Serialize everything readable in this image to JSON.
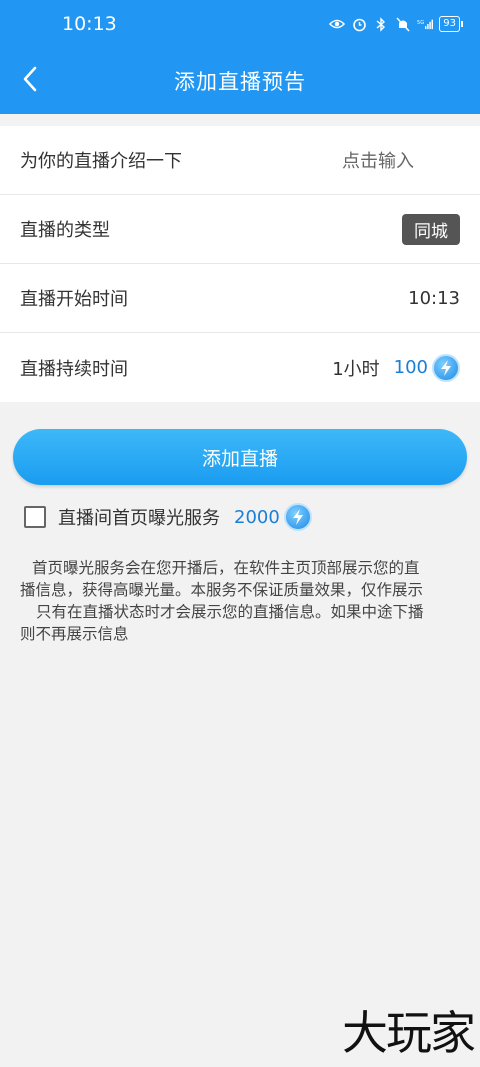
{
  "status_bar": {
    "time": "10:13",
    "battery": "93",
    "icons": [
      "eye-icon",
      "alarm-icon",
      "bluetooth-icon",
      "mute-icon",
      "5g-signal-icon"
    ]
  },
  "nav": {
    "back_icon": "chevron-left-icon",
    "title": "添加直播预告"
  },
  "form": {
    "intro": {
      "label": "为你的直播介绍一下",
      "placeholder": "点击输入"
    },
    "type": {
      "label": "直播的类型",
      "value": "同城"
    },
    "start": {
      "label": "直播开始时间",
      "value": "10:13"
    },
    "duration": {
      "label": "直播持续时间",
      "value": "1小时",
      "coins": "100",
      "coin_icon": "lightning-coin-icon"
    }
  },
  "add_button": {
    "label": "添加直播"
  },
  "service": {
    "label": "直播间首页曝光服务",
    "coins": "2000",
    "checked": false
  },
  "description": {
    "line1": "首页曝光服务会在您开播后，在软件主页顶部展示您的直",
    "line2": "播信息，获得高曝光量。本服务不保证质量效果，仅作展示",
    "line3": "只有在直播状态时才会展示您的直播信息。如果中途下播",
    "line4": "则不再展示信息"
  },
  "watermark": "大玩家",
  "colors": {
    "primary": "#2196f3",
    "button": "#1a9cf0",
    "coin_text": "#1a7fd6"
  }
}
